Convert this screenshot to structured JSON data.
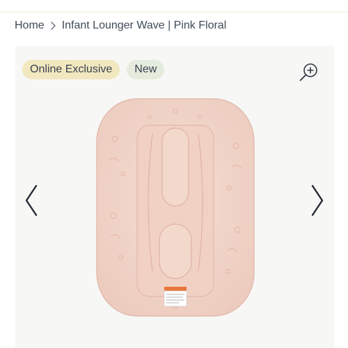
{
  "breadcrumb": {
    "home": "Home",
    "separator_icon": "chevron-right-icon",
    "current": "Infant Lounger Wave | Pink Floral"
  },
  "badges": {
    "online_exclusive": "Online Exclusive",
    "new": "New"
  },
  "icons": {
    "zoom": "zoom-in-icon",
    "prev": "chevron-left-icon",
    "next": "chevron-right-icon"
  },
  "product_image": {
    "description_icon": "infant-lounger-image",
    "colors": {
      "fabric": "#f1d8cc",
      "pattern": "#e3b3aa",
      "tag": "#e8763c"
    }
  },
  "colors": {
    "badge_online_bg": "#f2e8bf",
    "badge_new_bg": "#e6ecdd",
    "gallery_bg": "#f7f7f6",
    "text": "#3f4a57"
  }
}
